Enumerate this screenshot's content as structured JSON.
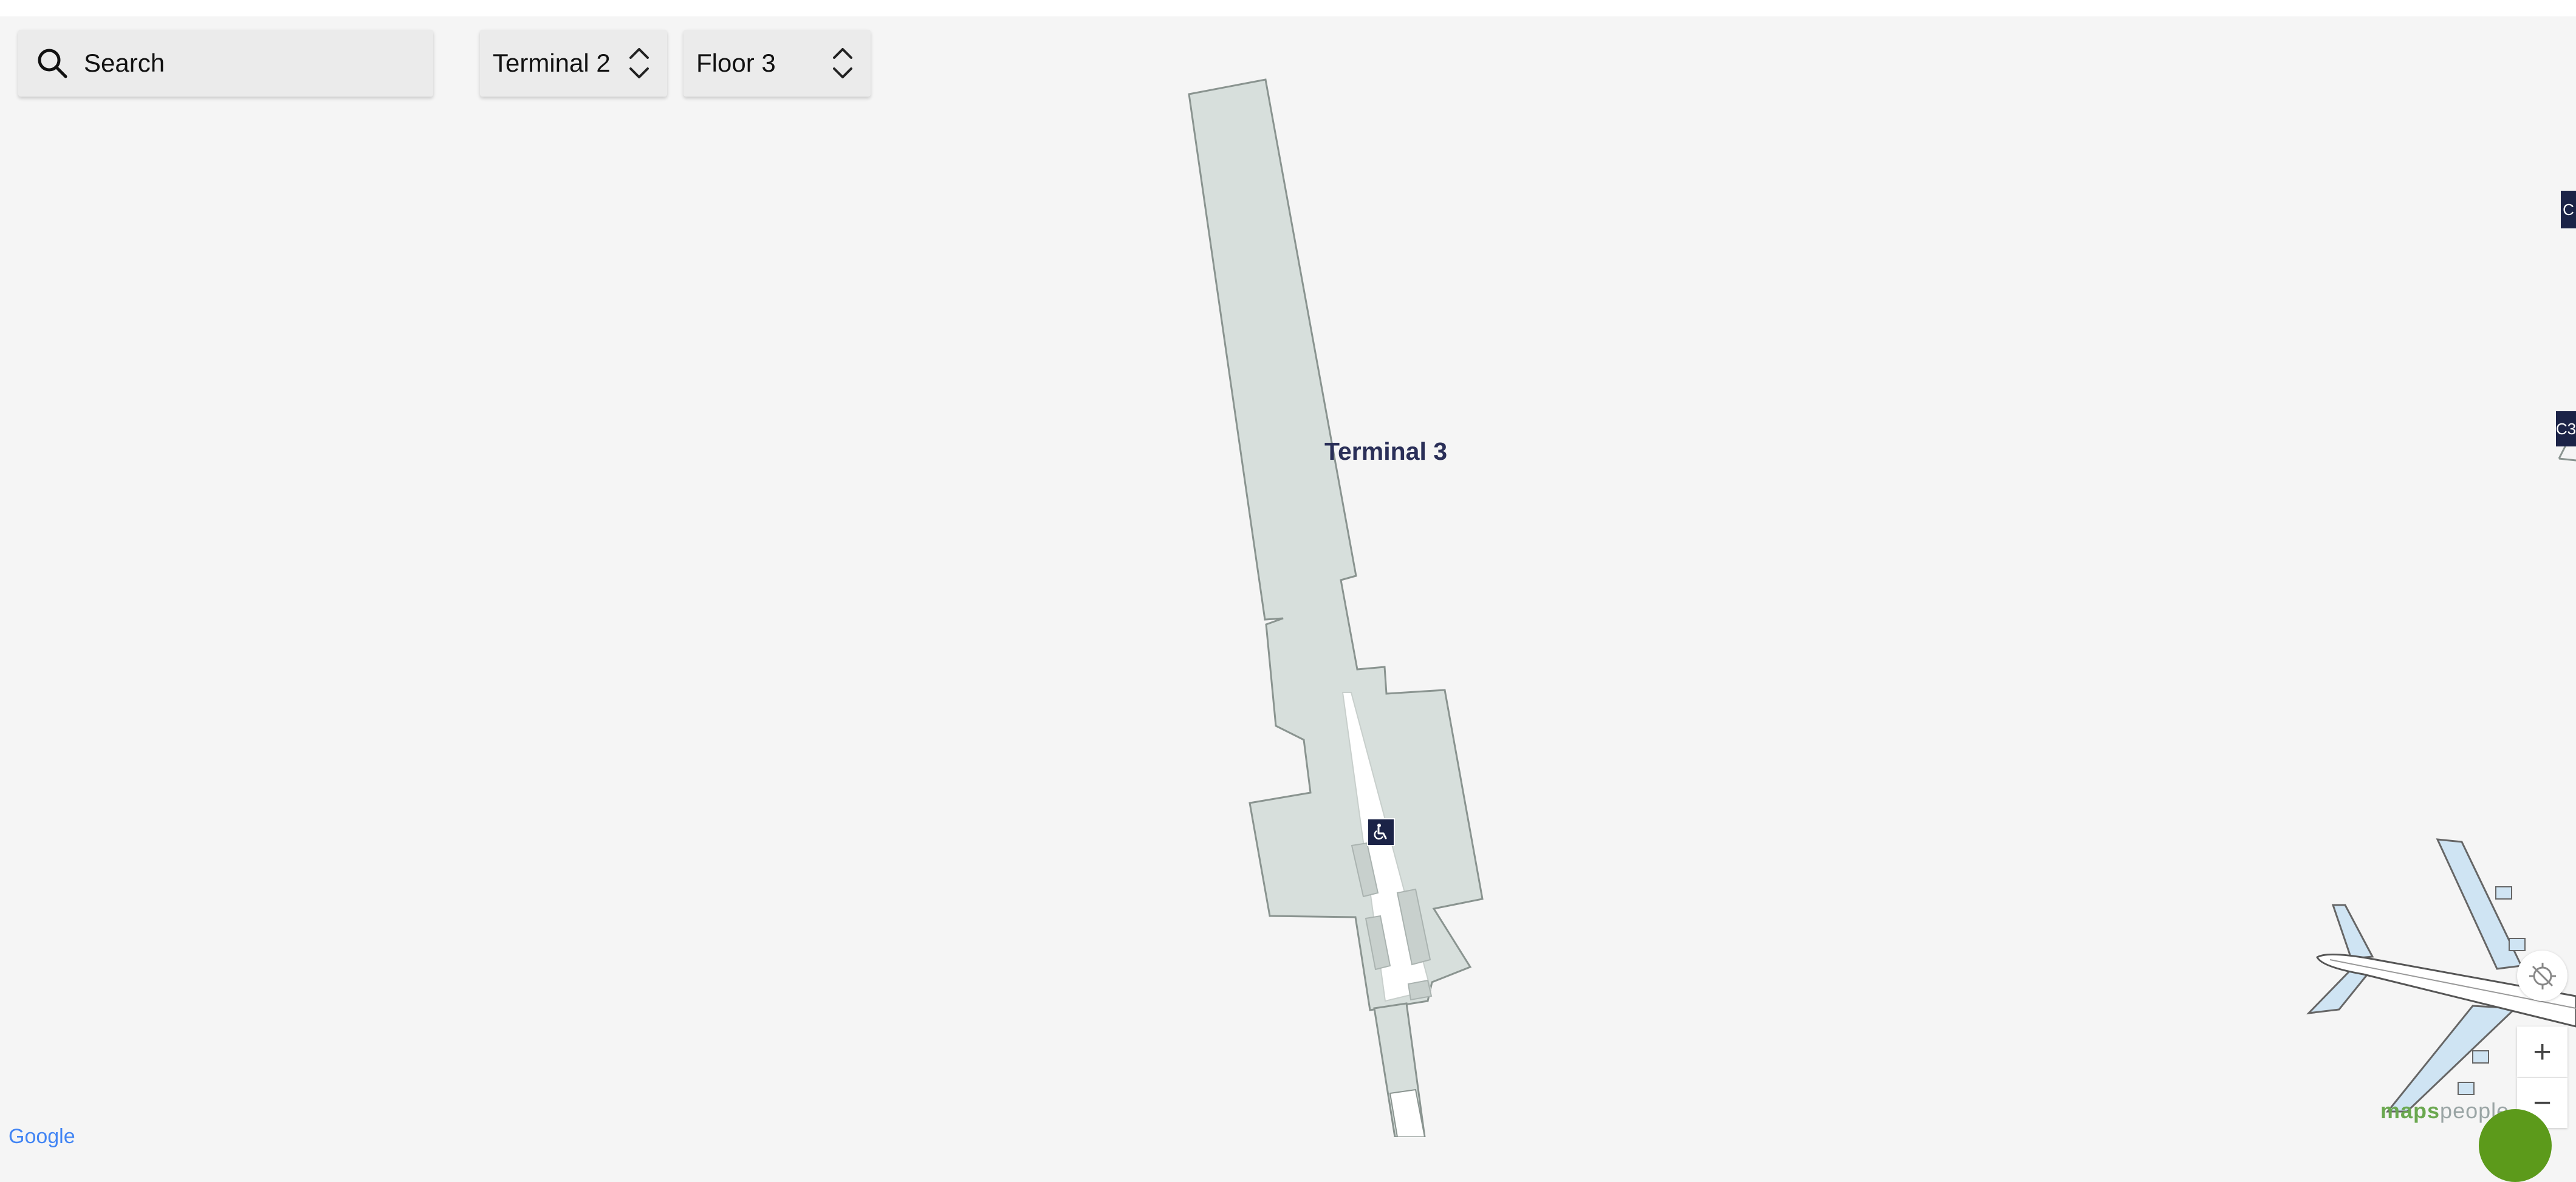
{
  "search": {
    "placeholder": "Search",
    "icon": "search-icon"
  },
  "venue_selector": {
    "label": "Terminal 2",
    "icon": "up-down-chevron-icon"
  },
  "floor_selector": {
    "label": "Floor 3",
    "icon": "up-down-chevron-icon"
  },
  "map": {
    "building_label": "Terminal 3",
    "wc_marker_icon": "wheelchair-icon",
    "edge_labels": [
      "C",
      "C3"
    ],
    "colors": {
      "background": "#f5f5f5",
      "building_fill": "#d7dfdc",
      "marker": "#1b2347",
      "label": "#2a2f58"
    }
  },
  "controls": {
    "locate_icon": "locate-off-icon",
    "zoom_in": "+",
    "zoom_out": "−"
  },
  "attribution": {
    "brand_part1": "maps",
    "brand_part2": "people",
    "google": "Google"
  }
}
